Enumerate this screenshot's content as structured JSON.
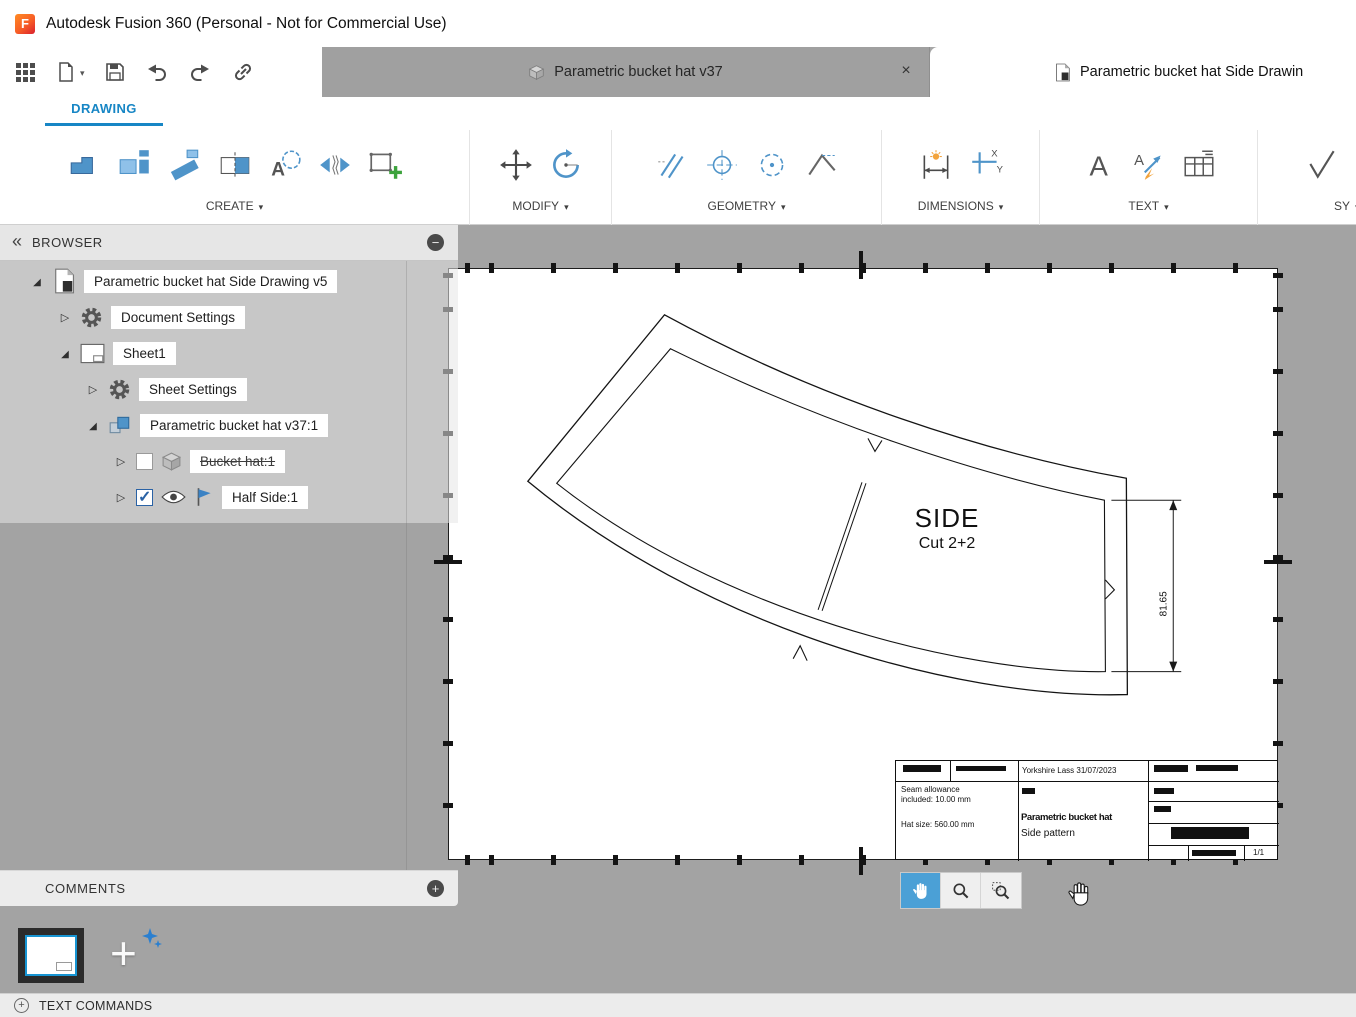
{
  "titlebar": {
    "app_title": "Autodesk Fusion 360 (Personal - Not for Commercial Use)"
  },
  "tabbar": {
    "inactive_tab": "Parametric bucket hat v37",
    "active_tab": "Parametric bucket hat Side Drawin"
  },
  "ribbon": {
    "workspace_tab": "DRAWING",
    "groups": {
      "create": "CREATE",
      "modify": "MODIFY",
      "geometry": "GEOMETRY",
      "dimensions": "DIMENSIONS",
      "text": "TEXT",
      "symbols": "SY"
    }
  },
  "browser": {
    "header": "BROWSER",
    "items": [
      {
        "label": "Parametric bucket hat Side Drawing v5"
      },
      {
        "label": "Document Settings"
      },
      {
        "label": "Sheet1"
      },
      {
        "label": "Sheet Settings"
      },
      {
        "label": "Parametric bucket hat v37:1"
      },
      {
        "label": "Bucket hat:1"
      },
      {
        "label": "Half Side:1"
      }
    ]
  },
  "sheet": {
    "part_label": "SIDE",
    "cut_label": "Cut 2+2",
    "dimension_value": "81.65",
    "titleblock": {
      "owner_date": "Yorkshire Lass  31/07/2023",
      "note_line1": "Seam allowance",
      "note_line2": "included: 10.00 mm",
      "note_line3": "Hat size: 560.00 mm",
      "title_line1": "Parametric bucket hat",
      "title_line2": "Side pattern",
      "sheet_number": "1/1"
    }
  },
  "comments": {
    "header": "COMMENTS"
  },
  "statusbar": {
    "text_commands": "TEXT COMMANDS"
  },
  "colors": {
    "accent_blue": "#0696d7",
    "icon_blue": "#4f94c9",
    "canvas_gray": "#a3a3a3"
  }
}
